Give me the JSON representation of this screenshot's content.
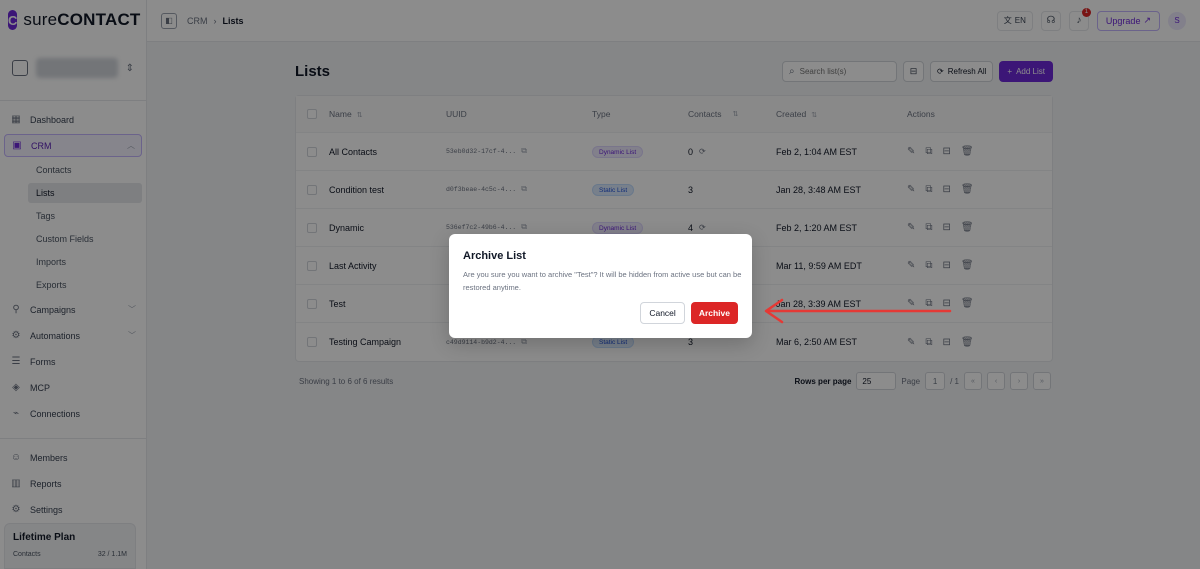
{
  "app": {
    "logo_prefix": "sure",
    "logo_suffix": "CONTACT"
  },
  "sidebar": {
    "items": [
      {
        "label": "Dashboard",
        "icon": "dashboard-icon"
      },
      {
        "label": "CRM",
        "icon": "crm-icon"
      },
      {
        "label": "Campaigns",
        "icon": "campaigns-icon"
      },
      {
        "label": "Automations",
        "icon": "automations-icon"
      },
      {
        "label": "Forms",
        "icon": "forms-icon"
      },
      {
        "label": "MCP",
        "icon": "mcp-icon"
      },
      {
        "label": "Connections",
        "icon": "connections-icon"
      },
      {
        "label": "Members",
        "icon": "members-icon"
      },
      {
        "label": "Reports",
        "icon": "reports-icon"
      },
      {
        "label": "Settings",
        "icon": "settings-icon"
      }
    ],
    "crm_sub": [
      "Contacts",
      "Lists",
      "Tags",
      "Custom Fields",
      "Imports",
      "Exports"
    ],
    "plan": {
      "title": "Lifetime Plan",
      "label": "Contacts",
      "value": "32 / 1.1M"
    }
  },
  "topbar": {
    "breadcrumb": [
      "CRM",
      "Lists"
    ],
    "lang": "EN",
    "notif_count": "1",
    "upgrade_label": "Upgrade",
    "avatar_initial": "S"
  },
  "page": {
    "title": "Lists",
    "search_placeholder": "Search list(s)",
    "refresh_label": "Refresh All",
    "add_label": "Add List"
  },
  "table": {
    "headers": {
      "name": "Name",
      "uuid": "UUID",
      "type": "Type",
      "contacts": "Contacts",
      "created": "Created",
      "actions": "Actions"
    },
    "rows": [
      {
        "name": "All Contacts",
        "uuid": "53eb0d32-17cf-4...",
        "type": "Dynamic List",
        "type_kind": "dynamic",
        "contacts": "0",
        "created": "Feb 2, 1:04 AM EST"
      },
      {
        "name": "Condition test",
        "uuid": "d0f3beae-4c5c-4...",
        "type": "Static List",
        "type_kind": "static",
        "contacts": "3",
        "created": "Jan 28, 3:48 AM EST"
      },
      {
        "name": "Dynamic",
        "uuid": "536ef7c2-49b6-4...",
        "type": "Dynamic List",
        "type_kind": "dynamic",
        "contacts": "4",
        "created": "Feb 2, 1:20 AM EST"
      },
      {
        "name": "Last Activity",
        "uuid": "",
        "type": "",
        "type_kind": "",
        "contacts": "",
        "created": "Mar 11, 9:59 AM EDT"
      },
      {
        "name": "Test",
        "uuid": "",
        "type": "",
        "type_kind": "",
        "contacts": "",
        "created": "Jan 28, 3:39 AM EST"
      },
      {
        "name": "Testing Campaign",
        "uuid": "c49d9114-b9d2-4...",
        "type": "Static List",
        "type_kind": "static",
        "contacts": "3",
        "created": "Mar 6, 2:50 AM EST"
      }
    ],
    "footer": {
      "showing": "Showing 1 to 6 of 6 results",
      "rows_per_page_label": "Rows per page",
      "rows_per_page": "25",
      "page_label": "Page",
      "page": "1",
      "page_total": "/ 1"
    }
  },
  "modal": {
    "title": "Archive List",
    "message": "Are you sure you want to archive \"Test\"? It will be hidden from active use but can be restored anytime.",
    "cancel_label": "Cancel",
    "archive_label": "Archive"
  },
  "colors": {
    "accent": "#6d28d9",
    "danger": "#dc2626",
    "arrow": "#e53935"
  }
}
